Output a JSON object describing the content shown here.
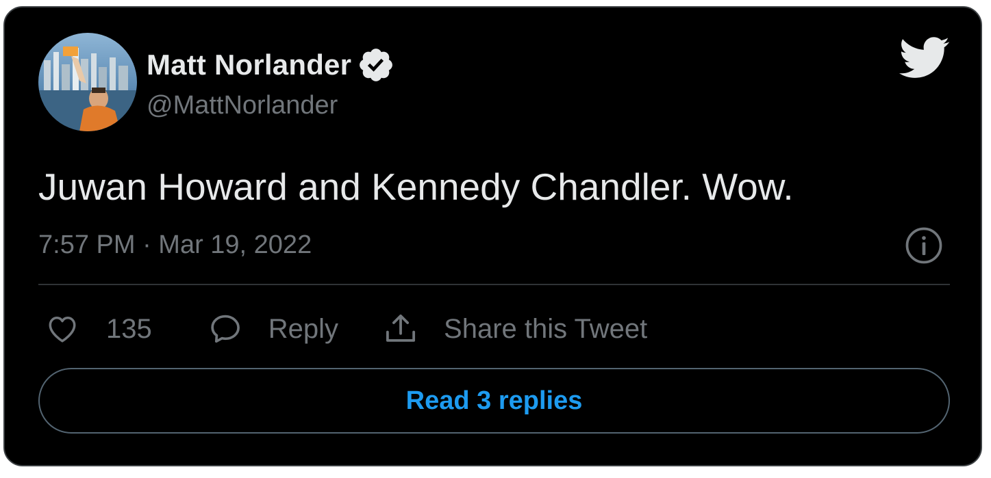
{
  "tweet": {
    "author": {
      "display_name": "Matt Norlander",
      "handle": "@MattNorlander",
      "verified": true,
      "avatar": "avatar-image"
    },
    "text": "Juwan Howard and Kennedy Chandler. Wow.",
    "timestamp": "7:57 PM · Mar 19, 2022",
    "actions": {
      "like_count": "135",
      "reply_label": "Reply",
      "share_label": "Share this Tweet"
    },
    "read_replies_label": "Read 3 replies"
  },
  "icons": {
    "logo": "twitter-bird-icon",
    "verified": "verified-badge-icon",
    "info": "info-icon",
    "like": "heart-icon",
    "reply": "speech-bubble-icon",
    "share": "share-upload-icon"
  },
  "colors": {
    "background": "#000000",
    "text_primary": "#e7e9ea",
    "text_secondary": "#71767b",
    "accent": "#1d9bf0",
    "border": "#3d4144"
  }
}
